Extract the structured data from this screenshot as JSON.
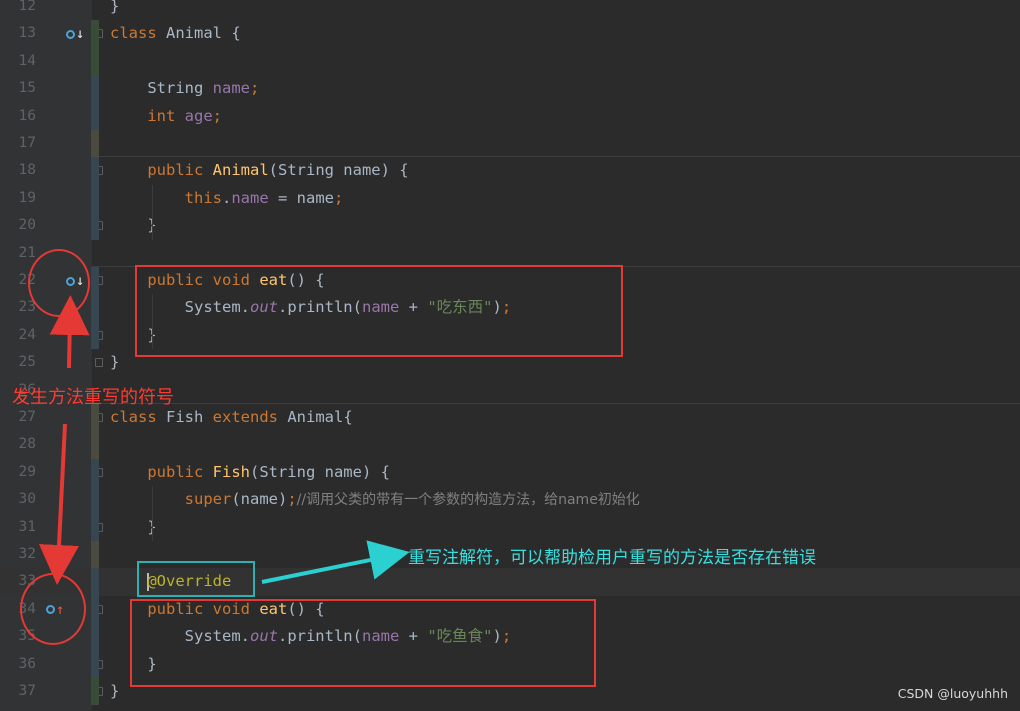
{
  "lines": [
    {
      "n": "12",
      "code": [
        [
          "",
          "}"
        ]
      ]
    },
    {
      "n": "13",
      "code": [
        [
          "kw",
          "class "
        ],
        [
          "",
          "Animal {"
        ]
      ]
    },
    {
      "n": "14",
      "code": []
    },
    {
      "n": "15",
      "code": [
        [
          "",
          "    String "
        ],
        [
          "fld",
          "name"
        ],
        [
          "punc",
          ";"
        ]
      ]
    },
    {
      "n": "16",
      "code": [
        [
          "kw",
          "    int "
        ],
        [
          "fld",
          "age"
        ],
        [
          "punc",
          ";"
        ]
      ]
    },
    {
      "n": "17",
      "code": []
    },
    {
      "n": "18",
      "code": [
        [
          "kw",
          "    public "
        ],
        [
          "fn",
          "Animal"
        ],
        [
          "",
          "(String name) {"
        ]
      ]
    },
    {
      "n": "19",
      "code": [
        [
          "kw",
          "        this"
        ],
        [
          "",
          "."
        ],
        [
          "fld",
          "name"
        ],
        [
          "",
          " = name"
        ],
        [
          "punc",
          ";"
        ]
      ]
    },
    {
      "n": "20",
      "code": [
        [
          "",
          "    }"
        ]
      ]
    },
    {
      "n": "21",
      "code": []
    },
    {
      "n": "22",
      "code": [
        [
          "kw",
          "    public void "
        ],
        [
          "fn",
          "eat"
        ],
        [
          "",
          "() {"
        ]
      ]
    },
    {
      "n": "23",
      "code": [
        [
          "",
          "        System."
        ],
        [
          "sfld",
          "out"
        ],
        [
          "",
          ".println("
        ],
        [
          "fld",
          "name"
        ],
        [
          "",
          " + "
        ],
        [
          "str",
          "\"吃东西\""
        ],
        [
          "",
          ")"
        ],
        [
          "punc",
          ";"
        ]
      ]
    },
    {
      "n": "24",
      "code": [
        [
          "",
          "    }"
        ]
      ]
    },
    {
      "n": "25",
      "code": [
        [
          "",
          "}"
        ]
      ]
    },
    {
      "n": "26",
      "code": []
    },
    {
      "n": "27",
      "code": [
        [
          "kw",
          "class "
        ],
        [
          "",
          "Fish "
        ],
        [
          "kw",
          "extends "
        ],
        [
          "",
          "Animal{"
        ]
      ]
    },
    {
      "n": "28",
      "code": []
    },
    {
      "n": "29",
      "code": [
        [
          "kw",
          "    public "
        ],
        [
          "fn",
          "Fish"
        ],
        [
          "",
          "(String name) {"
        ]
      ]
    },
    {
      "n": "30",
      "code": [
        [
          "kw",
          "        super"
        ],
        [
          "",
          "(name)"
        ],
        [
          "punc",
          ";"
        ],
        [
          "cmt",
          "//调用父类的带有一个参数的构造方法，给name初始化"
        ]
      ]
    },
    {
      "n": "31",
      "code": [
        [
          "",
          "    }"
        ]
      ]
    },
    {
      "n": "32",
      "code": []
    },
    {
      "n": "33",
      "code": [
        [
          "",
          "    "
        ],
        [
          "caret",
          ""
        ],
        [
          "ann",
          "@Override"
        ]
      ]
    },
    {
      "n": "34",
      "code": [
        [
          "kw",
          "    public void "
        ],
        [
          "fn",
          "eat"
        ],
        [
          "",
          "() {"
        ]
      ]
    },
    {
      "n": "35",
      "code": [
        [
          "",
          "        System."
        ],
        [
          "sfld",
          "out"
        ],
        [
          "",
          ".println("
        ],
        [
          "fld",
          "name"
        ],
        [
          "",
          " + "
        ],
        [
          "str",
          "\"吃鱼食\""
        ],
        [
          "",
          ")"
        ],
        [
          "punc",
          ";"
        ]
      ]
    },
    {
      "n": "36",
      "code": [
        [
          "",
          "    }"
        ]
      ]
    },
    {
      "n": "37",
      "code": [
        [
          "",
          "}"
        ]
      ]
    }
  ],
  "annotations": {
    "override_symbol_label": "发生方法重写的符号",
    "override_annotation_label": "重写注解符，可以帮助检用户重写的方法是否存在错误"
  },
  "watermark": "CSDN @luoyuhhh",
  "icons": {
    "overridden_marker": "overridden-method-icon",
    "overriding_marker": "overriding-method-icon"
  },
  "colors": {
    "background": "#2b2b2b",
    "keyword": "#cc7832",
    "field": "#9876aa",
    "method": "#ffc66d",
    "string": "#6a8759",
    "annotation": "#bbb529",
    "highlight_red": "#e53935",
    "highlight_teal": "#2bb3b3"
  }
}
